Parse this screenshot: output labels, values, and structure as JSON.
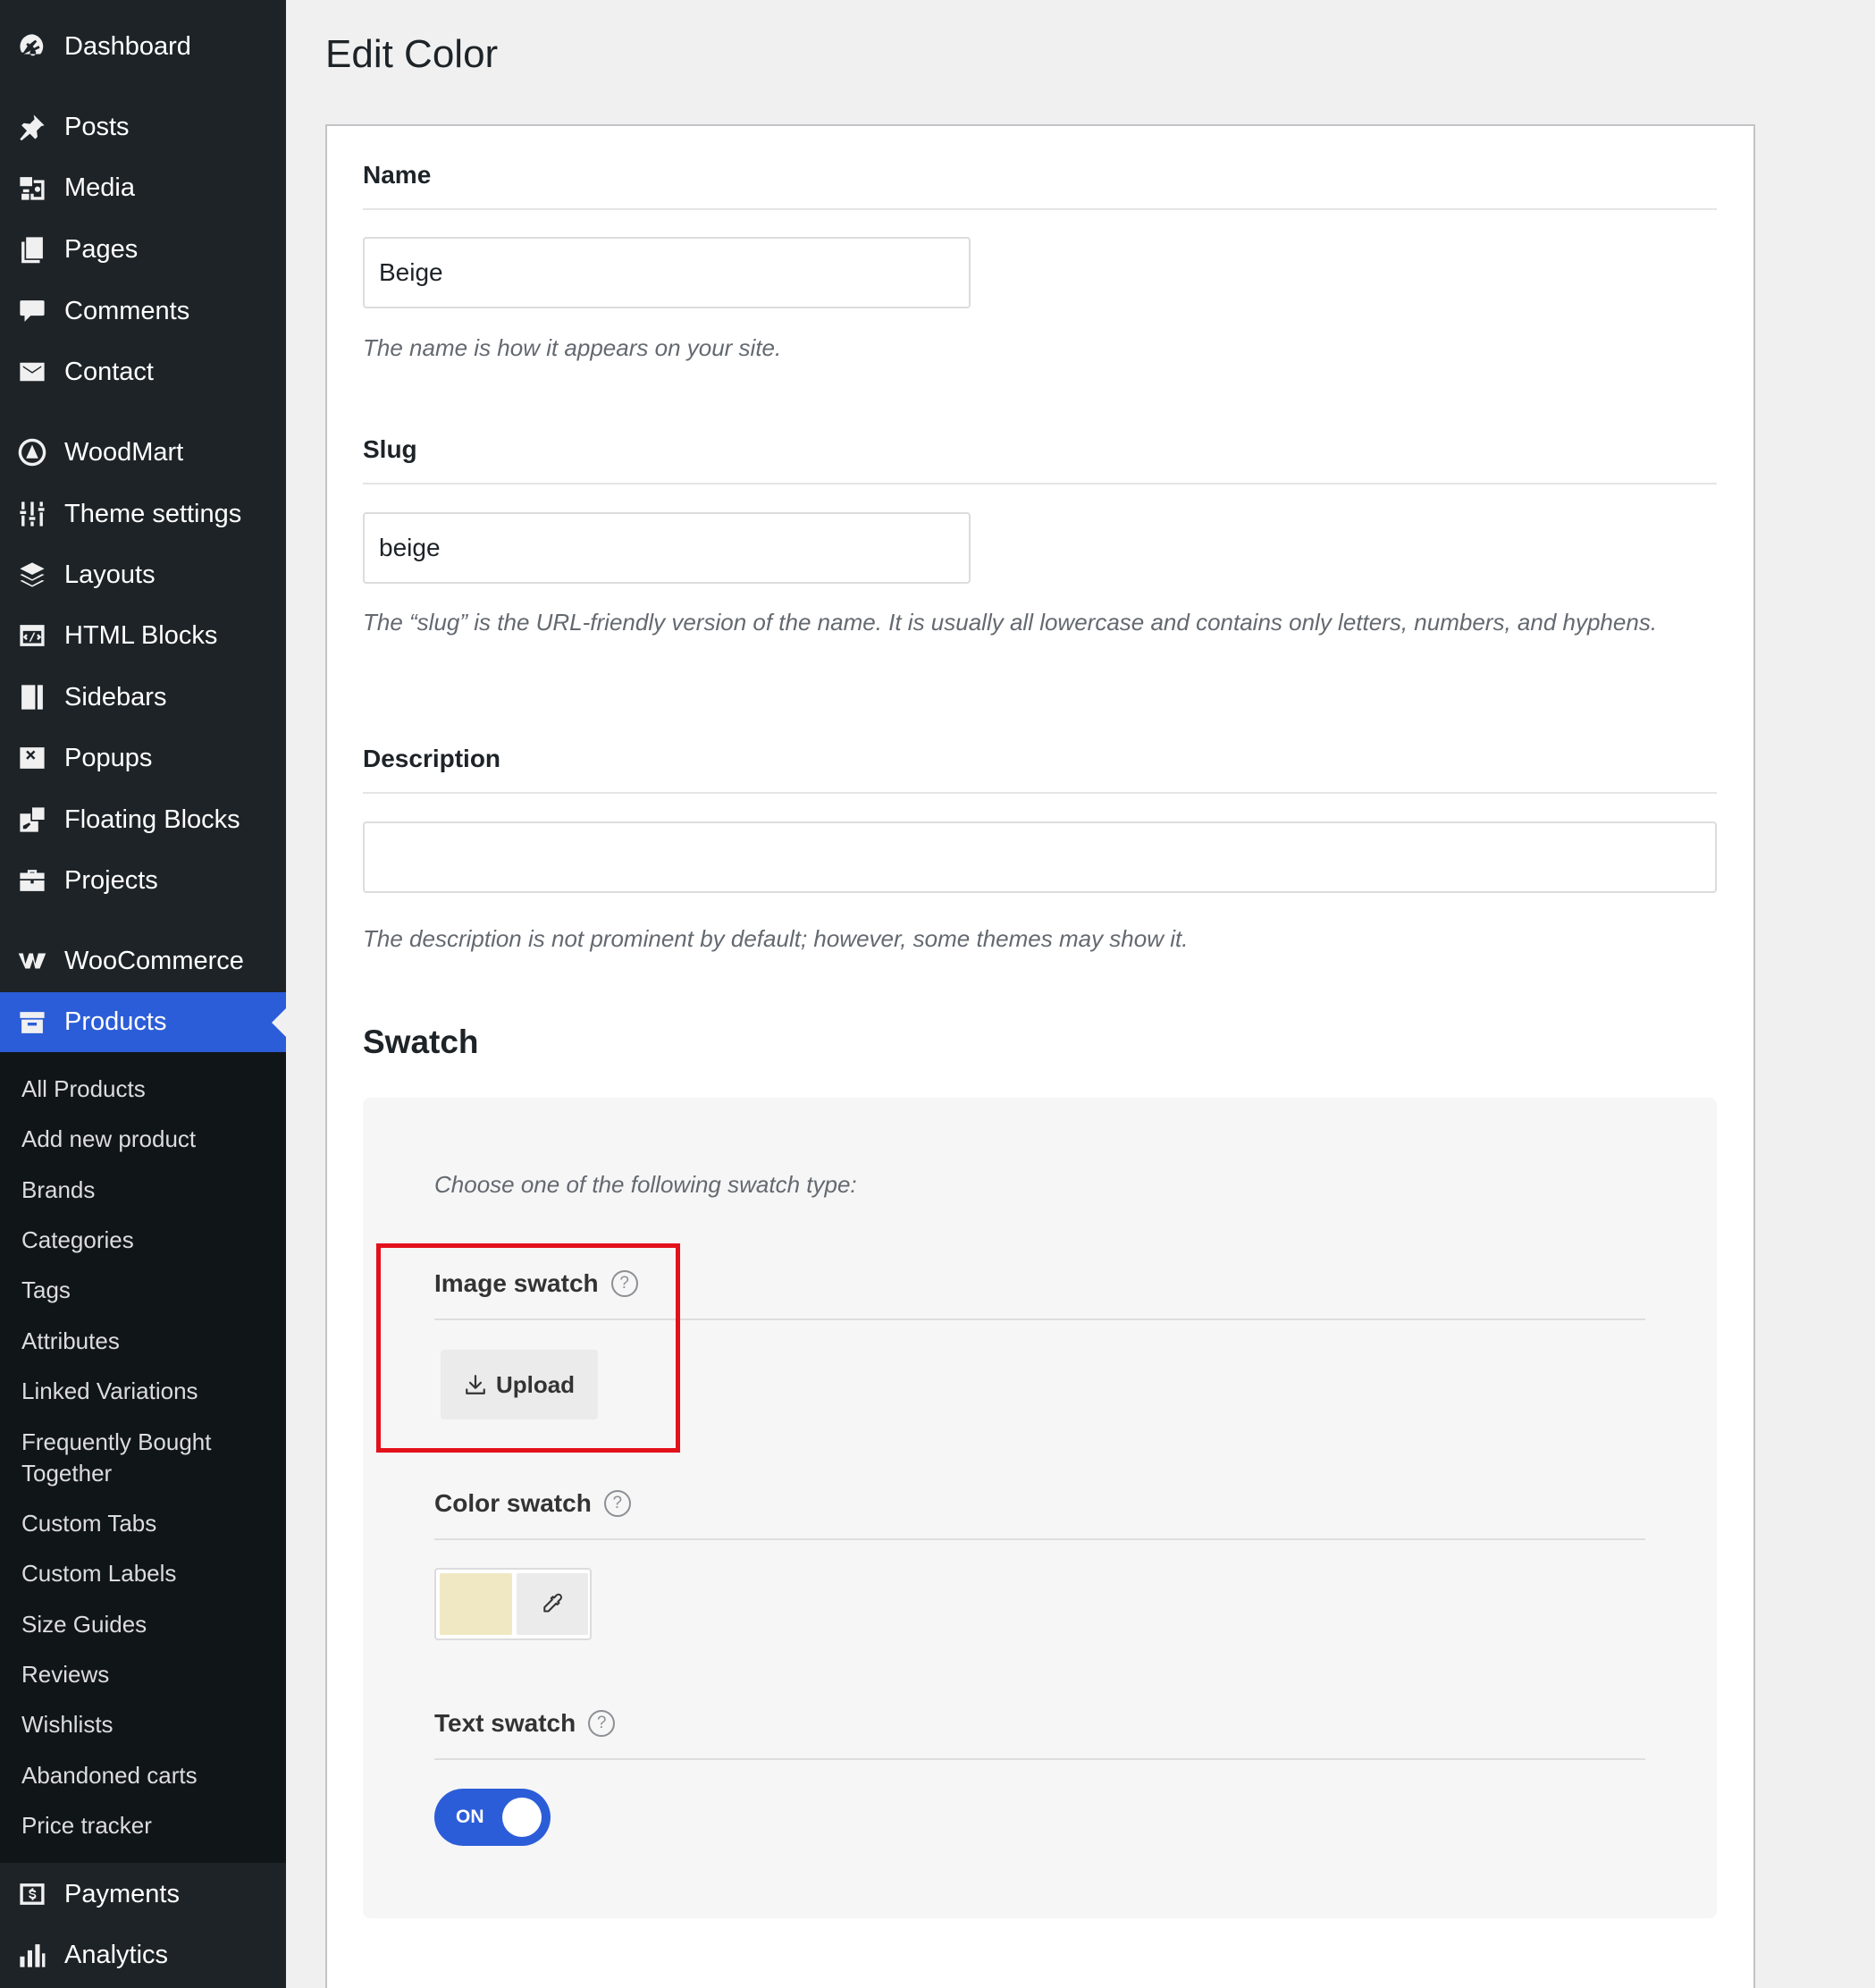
{
  "sidebar": {
    "menu": [
      {
        "label": "Dashboard",
        "icon": "dashboard-icon"
      },
      {
        "label": "Posts",
        "icon": "pin-icon"
      },
      {
        "label": "Media",
        "icon": "media-icon"
      },
      {
        "label": "Pages",
        "icon": "pages-icon"
      },
      {
        "label": "Comments",
        "icon": "comment-icon"
      },
      {
        "label": "Contact",
        "icon": "envelope-icon"
      },
      {
        "label": "WoodMart",
        "icon": "woodmart-icon"
      },
      {
        "label": "Theme settings",
        "icon": "sliders-icon"
      },
      {
        "label": "Layouts",
        "icon": "layers-icon"
      },
      {
        "label": "HTML Blocks",
        "icon": "code-block-icon"
      },
      {
        "label": "Sidebars",
        "icon": "sidebar-icon"
      },
      {
        "label": "Popups",
        "icon": "popup-icon"
      },
      {
        "label": "Floating Blocks",
        "icon": "floating-block-icon"
      },
      {
        "label": "Projects",
        "icon": "briefcase-icon"
      },
      {
        "label": "WooCommerce",
        "icon": "woocommerce-icon"
      },
      {
        "label": "Products",
        "icon": "archive-icon"
      }
    ],
    "submenu": [
      "All Products",
      "Add new product",
      "Brands",
      "Categories",
      "Tags",
      "Attributes",
      "Linked Variations",
      "Frequently Bought Together",
      "Custom Tabs",
      "Custom Labels",
      "Size Guides",
      "Reviews",
      "Wishlists",
      "Abandoned carts",
      "Price tracker"
    ],
    "bottom": [
      {
        "label": "Payments",
        "icon": "payments-icon"
      },
      {
        "label": "Analytics",
        "icon": "analytics-icon"
      }
    ]
  },
  "page": {
    "title": "Edit Color"
  },
  "form": {
    "name_label": "Name",
    "name_value": "Beige",
    "name_hint": "The name is how it appears on your site.",
    "slug_label": "Slug",
    "slug_value": "beige",
    "slug_hint": "The “slug” is the URL-friendly version of the name. It is usually all lowercase and contains only letters, numbers, and hyphens.",
    "description_label": "Description",
    "description_value": "",
    "description_hint": "The description is not prominent by default; however, some themes may show it."
  },
  "swatch": {
    "heading": "Swatch",
    "intro": "Choose one of the following swatch type:",
    "image_label": "Image swatch",
    "upload_label": "Upload",
    "color_label": "Color swatch",
    "color_value": "#f0e8c3",
    "text_label": "Text swatch",
    "toggle_label": "ON",
    "help_glyph": "?",
    "highlight_color": "#e2111b",
    "accent_color": "#2c5dd8"
  }
}
